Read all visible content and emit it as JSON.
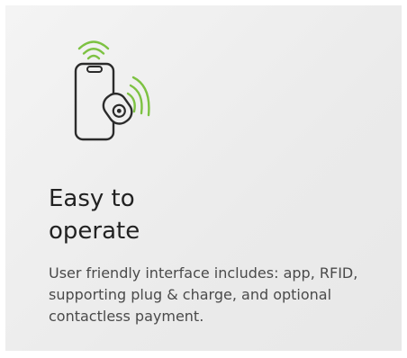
{
  "card": {
    "icon": "phone-contactless-icon",
    "title_line1": "Easy to",
    "title_line2": "operate",
    "description": "User friendly interface includes: app, RFID, supporting plug & charge, and optional contactless payment."
  },
  "colors": {
    "accent": "#7dc242",
    "outline": "#2b2b2b",
    "background": "#efefef",
    "title": "#222222",
    "text": "#4a4a4a"
  }
}
